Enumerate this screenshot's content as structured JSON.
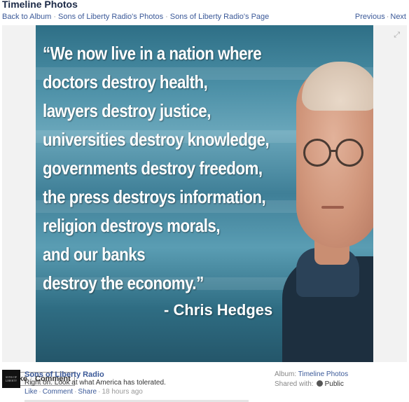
{
  "page": {
    "title": "Timeline Photos"
  },
  "nav": {
    "back_to_album": "Back to Album",
    "sons_photos": "Sons of Liberty Radio's Photos",
    "sons_page": "Sons of Liberty Radio's Page",
    "previous": "Previous",
    "next": "Next"
  },
  "photo": {
    "quote_lines": [
      "“We now live in a nation where",
      "doctors destroy health,",
      "lawyers destroy justice,",
      "universities destroy knowledge,",
      "governments destroy freedom,",
      "the press destroys information,",
      "religion destroys morals,",
      "and our banks",
      "destroy the economy.”"
    ],
    "author": "- Chris Hedges"
  },
  "like_bar": {
    "like": "Like",
    "comment": "Comment"
  },
  "post": {
    "avatar_text": "SONS OF LIBERTY",
    "poster": "Sons of Liberty Radio",
    "message": "Right on. Look at what America has tolerated.",
    "actions": {
      "like": "Like",
      "comment": "Comment",
      "share": "Share",
      "time": "18 hours ago"
    }
  },
  "sidebar": {
    "album_label": "Album:",
    "album_value": "Timeline Photos",
    "shared_label": "Shared with:",
    "shared_value": "Public"
  },
  "icons": {
    "expand": "expand-icon",
    "globe": "globe-icon"
  }
}
